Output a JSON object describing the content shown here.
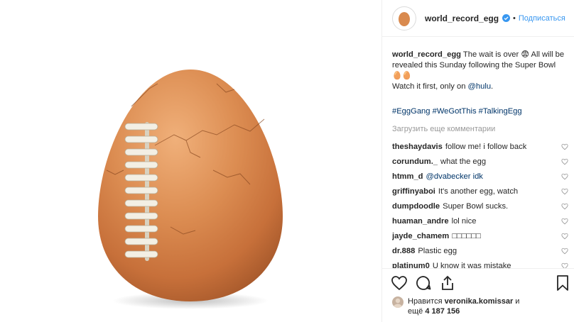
{
  "post": {
    "username": "world_record_egg",
    "follow_label": "Подписаться",
    "dot": "•"
  },
  "caption": {
    "username": "world_record_egg",
    "line1": "The wait is over 😨 All will be revealed this Sunday following the Super Bowl 🥚🥚",
    "line2_prefix": "Watch it first, only on ",
    "line2_link": "@hulu",
    "line2_suffix": ".",
    "hashtags": "#EggGang #WeGotThis #TalkingEgg"
  },
  "load_more_label": "Загрузить еще комментарии",
  "comments": [
    {
      "user": "theshaydavis",
      "text": "follow me! i follow back"
    },
    {
      "user": "corundum._",
      "text": "what the egg"
    },
    {
      "user": "htmm_d",
      "text": "@dvabecker idk"
    },
    {
      "user": "griffinyaboi",
      "text": "It's another egg, watch"
    },
    {
      "user": "dumpdoodle",
      "text": "Super Bowl sucks."
    },
    {
      "user": "huaman_andre",
      "text": "lol nice"
    },
    {
      "user": "jayde_chamem",
      "text": "□□□□□□"
    },
    {
      "user": "dr.888",
      "text": "Plastic egg"
    },
    {
      "user": "platinum0",
      "text": "U know it was mistake"
    }
  ],
  "likes": {
    "prefix": "Нравится",
    "user": "veronika.komissar",
    "mid": "и",
    "line2_prefix": "ещё",
    "count": "4 187 156"
  },
  "colors": {
    "accent": "#3897f0",
    "link": "#003569",
    "egg": "#d98a4e",
    "lace": "#f3efe4"
  },
  "icons": [
    "verified-icon",
    "heart-icon",
    "comment-icon",
    "share-icon",
    "bookmark-icon"
  ]
}
